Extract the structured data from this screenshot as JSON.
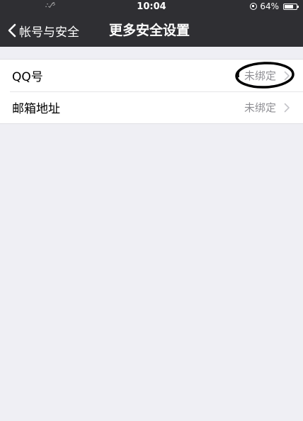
{
  "status_bar": {
    "signal": "∴⁄⁵",
    "time": "10:04",
    "battery": "64%"
  },
  "nav": {
    "back_label": "帐号与安全",
    "title": "更多安全设置"
  },
  "items": [
    {
      "label": "QQ号",
      "value": "未绑定"
    },
    {
      "label": "邮箱地址",
      "value": "未绑定"
    }
  ],
  "icons": {
    "back": "chevron-left-icon",
    "disclosure": "chevron-right-icon",
    "rotation_lock": "rotation-lock-icon",
    "battery": "battery-icon"
  },
  "colors": {
    "nav_background": "#2f2f33",
    "page_background": "#efeff4",
    "secondary_text": "#8e8e93",
    "annotation": "#000000"
  }
}
